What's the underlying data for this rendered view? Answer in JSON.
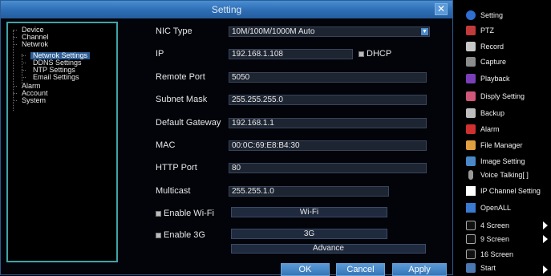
{
  "dialog": {
    "title": "Setting",
    "close": "✕",
    "tree": {
      "device": "Device",
      "channel": "Channel",
      "network": "Netwrok",
      "network_settings": "Netwrok Settings",
      "ddns": "DDNS Settings",
      "ntp": "NTP Settings",
      "email": "Email Settings",
      "alarm": "Alarm",
      "account": "Account",
      "system": "System"
    },
    "form": {
      "nic_type": {
        "label": "NIC Type",
        "value": "10M/100M/1000M Auto"
      },
      "ip": {
        "label": "IP",
        "value": "192.168.1.108"
      },
      "dhcp": {
        "label": "DHCP",
        "checked": false
      },
      "remote_port": {
        "label": "Remote Port",
        "value": "5050"
      },
      "subnet_mask": {
        "label": "Subnet Mask",
        "value": "255.255.255.0"
      },
      "default_gateway": {
        "label": "Default Gateway",
        "value": "192.168.1.1"
      },
      "mac": {
        "label": "MAC",
        "value": "00:0C:69:E8:B4:30"
      },
      "http_port": {
        "label": "HTTP Port",
        "value": "80"
      },
      "multicast": {
        "label": "Multicast",
        "value": "255.255.1.0"
      },
      "enable_wifi": {
        "label": "Enable Wi-Fi",
        "checked": false,
        "button": "Wi-Fi"
      },
      "enable_3g": {
        "label": "Enable 3G",
        "checked": false,
        "button": "3G"
      },
      "advance": "Advance"
    },
    "buttons": {
      "ok": "OK",
      "cancel": "Cancel",
      "apply": "Apply"
    }
  },
  "menu": {
    "items": [
      {
        "label": "Setting",
        "icon": "gear-icon",
        "color": "#2f6fd0"
      },
      {
        "label": "PTZ",
        "icon": "ptz-icon",
        "color": "#c23a3a"
      },
      {
        "label": "Record",
        "icon": "record-icon",
        "color": "#c8c8c8"
      },
      {
        "label": "Capture",
        "icon": "camera-icon",
        "color": "#8c8c8c"
      },
      {
        "label": "Playback",
        "icon": "play-icon",
        "color": "#7a3fb8"
      },
      {
        "label": "Disply Setting",
        "icon": "display-icon",
        "color": "#d0567a"
      },
      {
        "label": "Backup",
        "icon": "backup-icon",
        "color": "#bdbdbd"
      },
      {
        "label": "Alarm",
        "icon": "alarm-icon",
        "color": "#d03030"
      },
      {
        "label": "File Manager",
        "icon": "folder-icon",
        "color": "#e0a040"
      },
      {
        "label": "Image Setting",
        "icon": "image-icon",
        "color": "#4a88c8"
      },
      {
        "label": "Voice Talking[ ]",
        "icon": "microphone-icon",
        "color": "#999999"
      },
      {
        "label": "IP Channel Setting",
        "icon": "ip-channel-icon",
        "color": "#ffffff"
      },
      {
        "label": "OpenALL",
        "icon": "check-icon",
        "color": "#3a7ad0"
      },
      {
        "label": "4 Screen",
        "icon": "grid-4-icon",
        "color": "#333333"
      },
      {
        "label": "9 Screen",
        "icon": "grid-9-icon",
        "color": "#333333"
      },
      {
        "label": "16 Screen",
        "icon": "grid-16-icon",
        "color": "#333333"
      },
      {
        "label": "Start",
        "icon": "start-icon",
        "color": "#4a78b0"
      }
    ]
  }
}
